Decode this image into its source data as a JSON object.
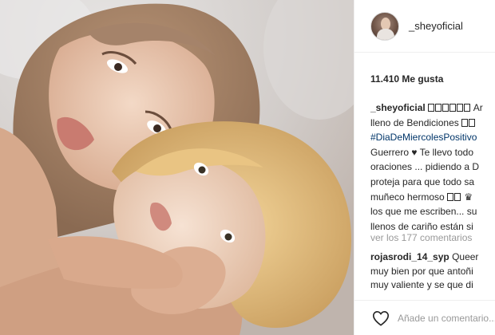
{
  "post": {
    "username": "_sheyoficial",
    "likes_text": "11.410 Me gusta"
  },
  "caption": {
    "line1_text": "Ar",
    "line2": "lleno de Bendiciones",
    "line3_hashtag": "#DiaDeMiercolesPositivo",
    "line4_a": "Guerrero",
    "line4_b": "Te llevo todo",
    "line5": "oraciones ... pidiendo a D",
    "line6": "proteja para que todo sa",
    "line7": "muñeco hermoso",
    "line8": "los que me escriben... su",
    "line9": "llenos de cariño están si"
  },
  "view_all_comments": "ver los 177 comentarios",
  "comment": {
    "username": "rojasrodi_14_syp",
    "line1_text": "Queer",
    "line2": "muy bien por que antoñi",
    "line3": "muy valiente y se que di"
  },
  "footer": {
    "add_comment_placeholder": "Añade un comentario...",
    "heart_icon": "heart-outline-icon"
  }
}
